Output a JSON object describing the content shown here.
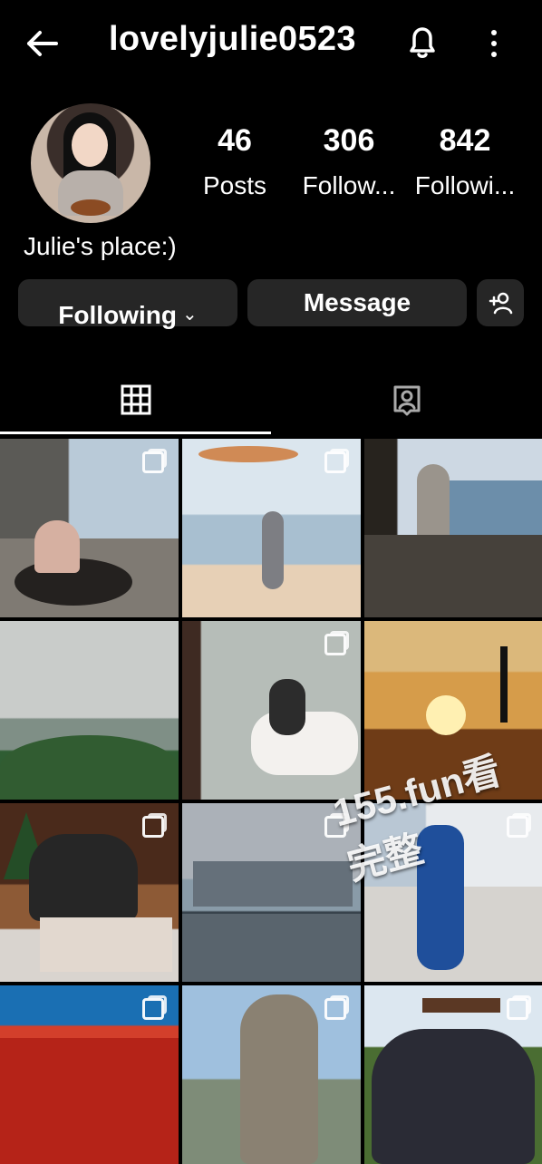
{
  "header": {
    "username": "lovelyjulie0523",
    "back_icon": "back-arrow-icon",
    "bell_icon": "bell-icon",
    "more_icon": "more-vertical-icon"
  },
  "profile": {
    "stats": [
      {
        "value": "46",
        "label": "Posts"
      },
      {
        "value": "306",
        "label": "Follow..."
      },
      {
        "value": "842",
        "label": "Followi..."
      }
    ],
    "bio": "Julie's place:)"
  },
  "actions": {
    "following_label": "Following",
    "message_label": "Message",
    "add_icon": "add-person-icon"
  },
  "tabs": [
    {
      "icon": "grid-icon"
    },
    {
      "icon": "tagged-person-icon"
    }
  ],
  "watermark": "155.fun看完整",
  "colors": {
    "background": "#000000",
    "button": "#262626",
    "text": "#ffffff"
  }
}
